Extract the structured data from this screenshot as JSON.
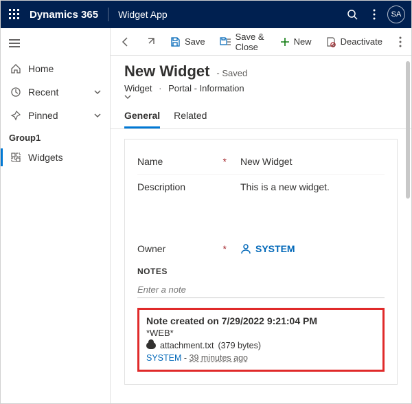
{
  "topbar": {
    "brand": "Dynamics 365",
    "app": "Widget App",
    "avatar": "SA"
  },
  "sidebar": {
    "home": "Home",
    "recent": "Recent",
    "pinned": "Pinned",
    "group_header": "Group1",
    "widgets": "Widgets"
  },
  "commands": {
    "save": "Save",
    "save_close": "Save & Close",
    "new": "New",
    "deactivate": "Deactivate"
  },
  "page": {
    "title": "New Widget",
    "save_state": "- Saved",
    "crumb_entity": "Widget",
    "crumb_form": "Portal - Information"
  },
  "tabs": {
    "general": "General",
    "related": "Related"
  },
  "fields": {
    "name_label": "Name",
    "name_value": "New Widget",
    "desc_label": "Description",
    "desc_value": "This is a new widget.",
    "owner_label": "Owner",
    "owner_value": "SYSTEM"
  },
  "notes": {
    "header": "NOTES",
    "placeholder": "Enter a note",
    "card": {
      "title": "Note created on 7/29/2022 9:21:04 PM",
      "tag": "*WEB*",
      "attachment_name": "attachment.txt",
      "attachment_size": "(379 bytes)",
      "user": "SYSTEM",
      "sep": " - ",
      "time": "39 minutes ago"
    }
  }
}
